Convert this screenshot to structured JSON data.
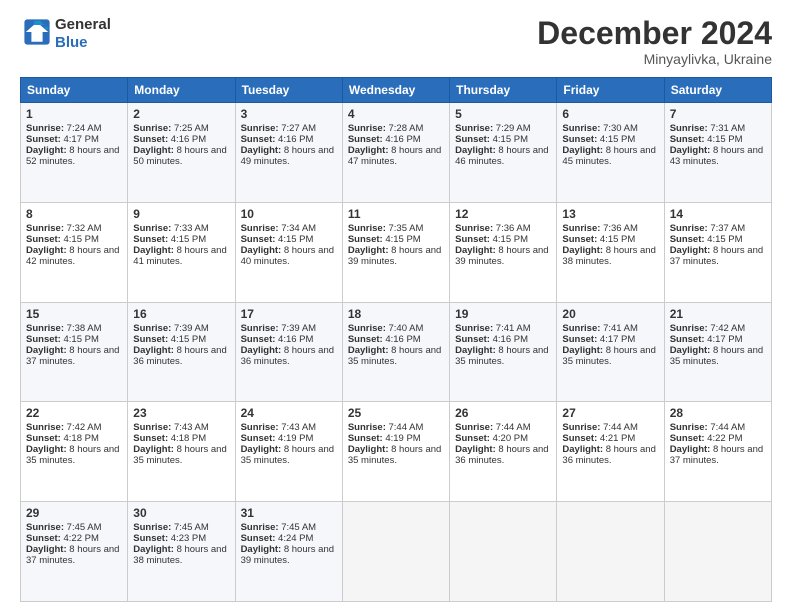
{
  "logo": {
    "line1": "General",
    "line2": "Blue"
  },
  "header": {
    "month": "December 2024",
    "location": "Minyaylivka, Ukraine"
  },
  "weekdays": [
    "Sunday",
    "Monday",
    "Tuesday",
    "Wednesday",
    "Thursday",
    "Friday",
    "Saturday"
  ],
  "weeks": [
    [
      {
        "day": "1",
        "sunrise": "7:24 AM",
        "sunset": "4:17 PM",
        "daylight": "8 hours and 52 minutes."
      },
      {
        "day": "2",
        "sunrise": "7:25 AM",
        "sunset": "4:16 PM",
        "daylight": "8 hours and 50 minutes."
      },
      {
        "day": "3",
        "sunrise": "7:27 AM",
        "sunset": "4:16 PM",
        "daylight": "8 hours and 49 minutes."
      },
      {
        "day": "4",
        "sunrise": "7:28 AM",
        "sunset": "4:16 PM",
        "daylight": "8 hours and 47 minutes."
      },
      {
        "day": "5",
        "sunrise": "7:29 AM",
        "sunset": "4:15 PM",
        "daylight": "8 hours and 46 minutes."
      },
      {
        "day": "6",
        "sunrise": "7:30 AM",
        "sunset": "4:15 PM",
        "daylight": "8 hours and 45 minutes."
      },
      {
        "day": "7",
        "sunrise": "7:31 AM",
        "sunset": "4:15 PM",
        "daylight": "8 hours and 43 minutes."
      }
    ],
    [
      {
        "day": "8",
        "sunrise": "7:32 AM",
        "sunset": "4:15 PM",
        "daylight": "8 hours and 42 minutes."
      },
      {
        "day": "9",
        "sunrise": "7:33 AM",
        "sunset": "4:15 PM",
        "daylight": "8 hours and 41 minutes."
      },
      {
        "day": "10",
        "sunrise": "7:34 AM",
        "sunset": "4:15 PM",
        "daylight": "8 hours and 40 minutes."
      },
      {
        "day": "11",
        "sunrise": "7:35 AM",
        "sunset": "4:15 PM",
        "daylight": "8 hours and 39 minutes."
      },
      {
        "day": "12",
        "sunrise": "7:36 AM",
        "sunset": "4:15 PM",
        "daylight": "8 hours and 39 minutes."
      },
      {
        "day": "13",
        "sunrise": "7:36 AM",
        "sunset": "4:15 PM",
        "daylight": "8 hours and 38 minutes."
      },
      {
        "day": "14",
        "sunrise": "7:37 AM",
        "sunset": "4:15 PM",
        "daylight": "8 hours and 37 minutes."
      }
    ],
    [
      {
        "day": "15",
        "sunrise": "7:38 AM",
        "sunset": "4:15 PM",
        "daylight": "8 hours and 37 minutes."
      },
      {
        "day": "16",
        "sunrise": "7:39 AM",
        "sunset": "4:15 PM",
        "daylight": "8 hours and 36 minutes."
      },
      {
        "day": "17",
        "sunrise": "7:39 AM",
        "sunset": "4:16 PM",
        "daylight": "8 hours and 36 minutes."
      },
      {
        "day": "18",
        "sunrise": "7:40 AM",
        "sunset": "4:16 PM",
        "daylight": "8 hours and 35 minutes."
      },
      {
        "day": "19",
        "sunrise": "7:41 AM",
        "sunset": "4:16 PM",
        "daylight": "8 hours and 35 minutes."
      },
      {
        "day": "20",
        "sunrise": "7:41 AM",
        "sunset": "4:17 PM",
        "daylight": "8 hours and 35 minutes."
      },
      {
        "day": "21",
        "sunrise": "7:42 AM",
        "sunset": "4:17 PM",
        "daylight": "8 hours and 35 minutes."
      }
    ],
    [
      {
        "day": "22",
        "sunrise": "7:42 AM",
        "sunset": "4:18 PM",
        "daylight": "8 hours and 35 minutes."
      },
      {
        "day": "23",
        "sunrise": "7:43 AM",
        "sunset": "4:18 PM",
        "daylight": "8 hours and 35 minutes."
      },
      {
        "day": "24",
        "sunrise": "7:43 AM",
        "sunset": "4:19 PM",
        "daylight": "8 hours and 35 minutes."
      },
      {
        "day": "25",
        "sunrise": "7:44 AM",
        "sunset": "4:19 PM",
        "daylight": "8 hours and 35 minutes."
      },
      {
        "day": "26",
        "sunrise": "7:44 AM",
        "sunset": "4:20 PM",
        "daylight": "8 hours and 36 minutes."
      },
      {
        "day": "27",
        "sunrise": "7:44 AM",
        "sunset": "4:21 PM",
        "daylight": "8 hours and 36 minutes."
      },
      {
        "day": "28",
        "sunrise": "7:44 AM",
        "sunset": "4:22 PM",
        "daylight": "8 hours and 37 minutes."
      }
    ],
    [
      {
        "day": "29",
        "sunrise": "7:45 AM",
        "sunset": "4:22 PM",
        "daylight": "8 hours and 37 minutes."
      },
      {
        "day": "30",
        "sunrise": "7:45 AM",
        "sunset": "4:23 PM",
        "daylight": "8 hours and 38 minutes."
      },
      {
        "day": "31",
        "sunrise": "7:45 AM",
        "sunset": "4:24 PM",
        "daylight": "8 hours and 39 minutes."
      },
      null,
      null,
      null,
      null
    ]
  ],
  "labels": {
    "sunrise": "Sunrise:",
    "sunset": "Sunset:",
    "daylight": "Daylight:"
  }
}
